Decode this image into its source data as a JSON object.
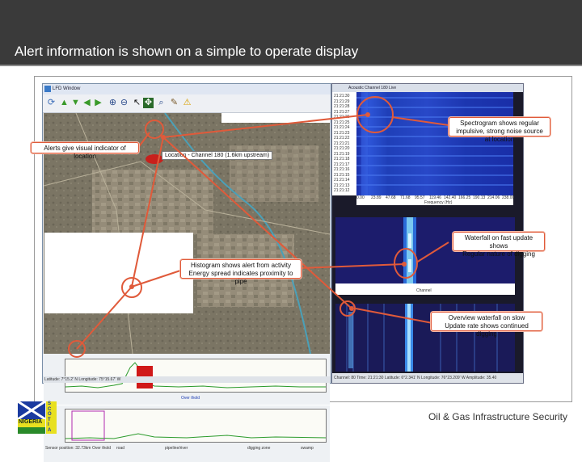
{
  "slide": {
    "title": "Alert information is shown on a simple to operate display",
    "footer": "Oil & Gas Infrastructure Security",
    "logo": {
      "word": "NIGERIA",
      "side_letters": [
        "S",
        "C",
        "O",
        "T",
        "I",
        "A"
      ]
    }
  },
  "lfd_window": {
    "title": "LFD Window",
    "location_label": "Location - Channel 180 (1.6km upstream)",
    "histogram_label": "Over thold",
    "status_fields": [
      "Sensor position: 32.73km",
      "Over thold",
      "road",
      "pipeline/river",
      "digging zone",
      "swamp"
    ],
    "status_bar": "Latitude: 7°15.2' N  Longitude: 75°15.67' W"
  },
  "acoustic_window": {
    "title": "Acoustic Channel 180 Live",
    "timestamps": [
      "21:21:30",
      "21:21:29",
      "21:21:28",
      "21:21:27",
      "21:21:26",
      "21:21:25",
      "21:21:24",
      "21:21:23",
      "21:21:22",
      "21:21:21",
      "21:21:20",
      "21:21:19",
      "21:21:18",
      "21:21:17",
      "21:21:16",
      "21:21:15",
      "21:21:14",
      "21:21:13",
      "21:21:12"
    ],
    "freq_ticks": [
      "0.00",
      "23.89",
      "47.68",
      "71.68",
      "95.57",
      "119.46",
      "142.40",
      "166.25",
      "190.13",
      "214.06",
      "238.00"
    ],
    "freq_label": "Frequency (Hz)",
    "channel_label": "Channel",
    "status_bar": "Channel: 80  Time: 21:21:30  Latitude: 6°2.341' N  Longitude: 76°23.209' W  Amplitude: 35.40"
  },
  "callouts": {
    "alerts": "Alerts give visual indicator of location",
    "spectrogram": [
      "Spectrogram shows regular",
      "impulsive, strong noise source at location"
    ],
    "waterfall_fast": [
      "Waterfall on fast update shows",
      "Regular nature of digging"
    ],
    "histogram": [
      "Histogram shows alert from activity",
      "Energy spread indicates proximity to pipe"
    ],
    "overview": [
      "Overview waterfall on slow",
      "Update rate shows continued digging"
    ]
  },
  "colors": {
    "title_bar": "#3a3a3a",
    "callout_line": "#e05a3a",
    "spectrogram": "#2040c0",
    "alert": "#c8201c"
  }
}
